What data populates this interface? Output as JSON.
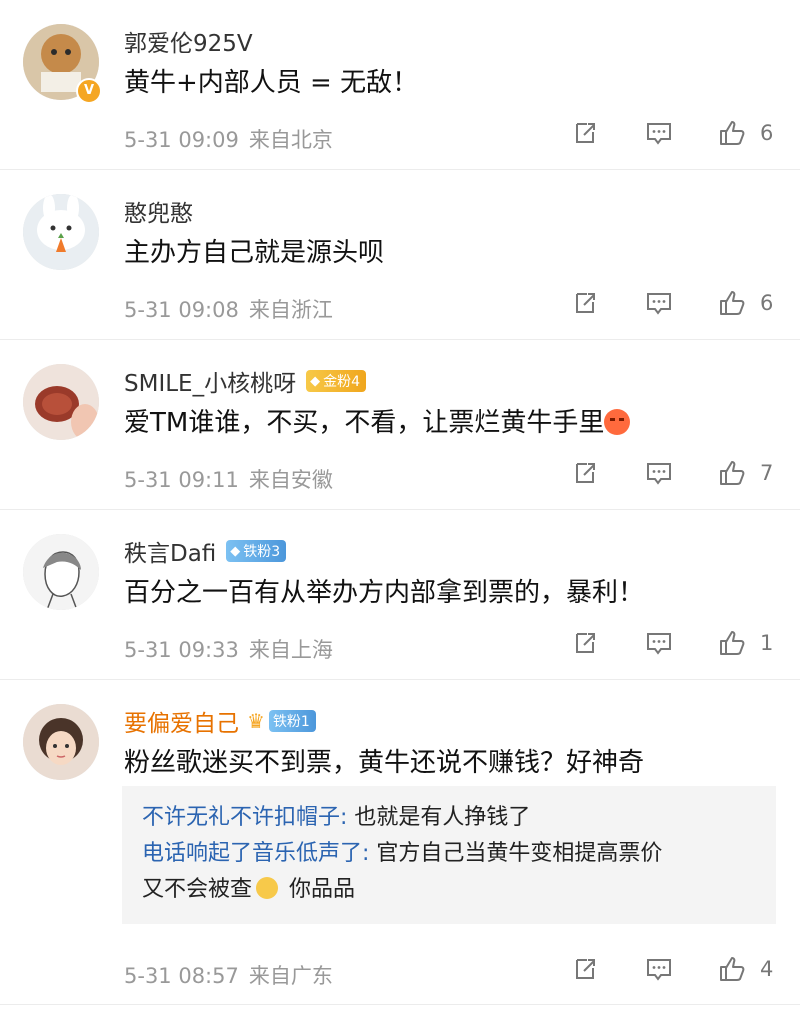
{
  "comments": [
    {
      "username": "郭爱伦925V",
      "text": "黄牛+内部人员 = 无敌！",
      "time": "5-31 09:09",
      "location": "来自北京",
      "likes": "6",
      "verified": "V"
    },
    {
      "username": "憨兜憨",
      "text": "主办方自己就是源头呗",
      "time": "5-31 09:08",
      "location": "来自浙江",
      "likes": "6"
    },
    {
      "username": "SMILE_小核桃呀",
      "badge": "金粉4",
      "text": "爱TM谁谁，不买，不看，让票烂黄牛手里",
      "time": "5-31 09:11",
      "location": "来自安徽",
      "likes": "7"
    },
    {
      "username": "秩言Dafi",
      "badge": "铁粉3",
      "text": "百分之一百有从举办方内部拿到票的，暴利！",
      "time": "5-31 09:33",
      "location": "来自上海",
      "likes": "1"
    },
    {
      "username": "要偏爱自己",
      "badge": "铁粉1",
      "text": "粉丝歌迷买不到票，黄牛还说不赚钱？好神奇",
      "time": "5-31 08:57",
      "location": "来自广东",
      "likes": "4",
      "replies": [
        {
          "name": "不许无礼不许扣帽子:",
          "text": " 也就是有人挣钱了"
        },
        {
          "name": "电话响起了音乐低声了:",
          "text": " 官方自己当黄牛变相提高票价"
        },
        {
          "name": "",
          "text": "又不会被查",
          "tail": " 你品品"
        }
      ]
    }
  ],
  "colors": {
    "vip_name": "#e77200",
    "reply_name": "#2b64b1",
    "meta_gray": "#999999",
    "gold_badge": "#f0a61d",
    "iron_badge": "#4c97db"
  },
  "icons": [
    "share-icon",
    "comment-icon",
    "thumbs-up-icon",
    "verified-v-icon",
    "diamond-icon",
    "crown-icon",
    "angry-face-emoji",
    "dog-face-emoji"
  ]
}
